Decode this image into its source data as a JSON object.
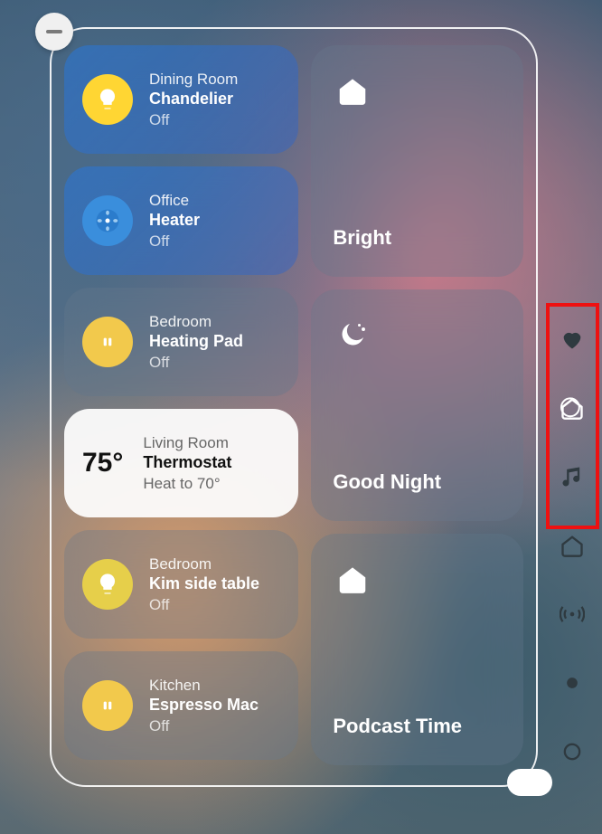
{
  "tiles": [
    {
      "room": "Dining Room",
      "name": "Chandelier",
      "status": "Off",
      "icon": "bulb",
      "style": "blue"
    },
    {
      "room": "Office",
      "name": "Heater",
      "status": "Off",
      "icon": "fan",
      "style": "blue"
    },
    {
      "room": "Bedroom",
      "name": "Heating Pad",
      "status": "Off",
      "icon": "outlet",
      "style": "grey"
    },
    {
      "room": "Living Room",
      "name": "Thermostat",
      "status": "Heat to 70°",
      "icon": "temp",
      "style": "white",
      "temp": "75°"
    },
    {
      "room": "Bedroom",
      "name": "Kim side table",
      "status": "Off",
      "icon": "bulb",
      "style": "grey"
    },
    {
      "room": "Kitchen",
      "name": "Espresso Mac",
      "status": "Off",
      "icon": "outlet",
      "style": "grey"
    }
  ],
  "scenes": [
    {
      "label": "Bright",
      "icon": "home"
    },
    {
      "label": "Good Night",
      "icon": "moon"
    },
    {
      "label": "Podcast Time",
      "icon": "home"
    }
  ],
  "sidebar": [
    {
      "name": "favorites-icon",
      "icon": "heart",
      "active": false
    },
    {
      "name": "home-icon",
      "icon": "home",
      "active": true
    },
    {
      "name": "music-icon",
      "icon": "music",
      "active": false
    },
    {
      "name": "home2-icon",
      "icon": "home",
      "active": false
    },
    {
      "name": "broadcast-icon",
      "icon": "broadcast",
      "active": false
    },
    {
      "name": "dot-icon",
      "icon": "dot",
      "active": false
    },
    {
      "name": "ring-icon",
      "icon": "ring",
      "active": false
    }
  ]
}
